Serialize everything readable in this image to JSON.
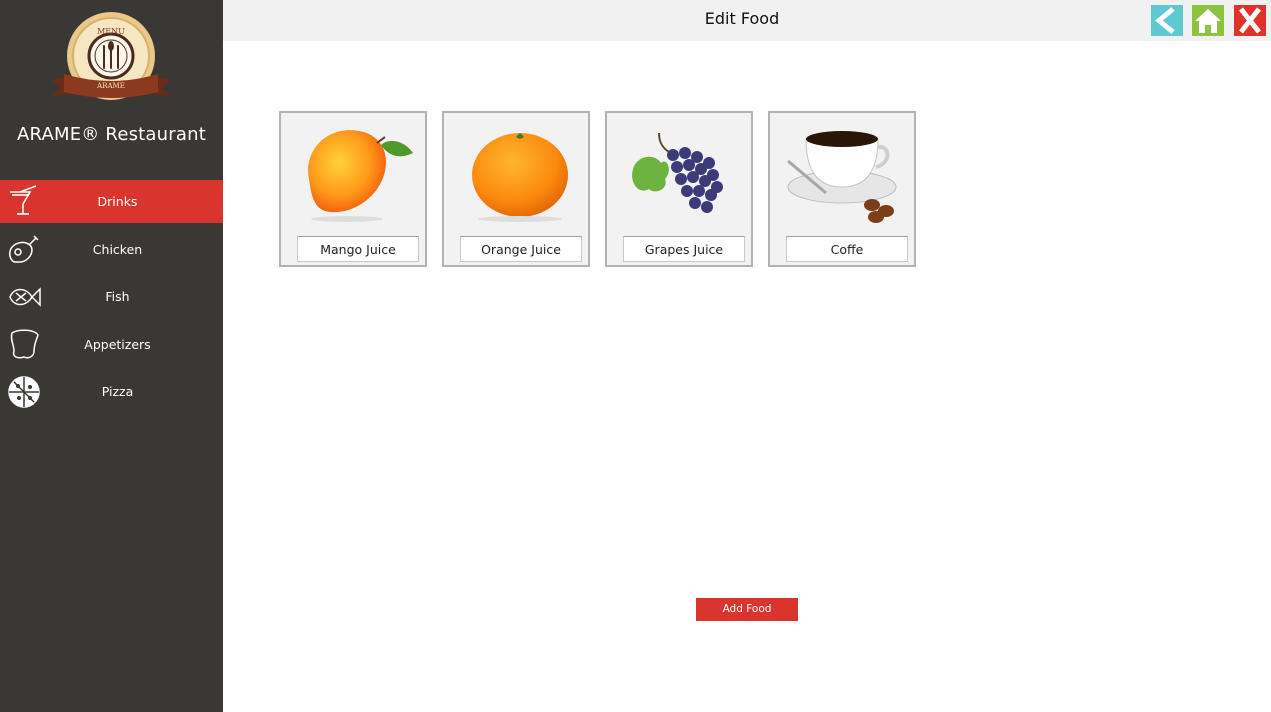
{
  "sidebar": {
    "brand": "ARAME® Restaurant",
    "logo": {
      "top_text": "MENU",
      "ribbon_text": "ARAME"
    },
    "items": [
      {
        "label": "Drinks",
        "icon": "drink-icon",
        "active": true
      },
      {
        "label": "Chicken",
        "icon": "chicken-icon",
        "active": false
      },
      {
        "label": "Fish",
        "icon": "fish-icon",
        "active": false
      },
      {
        "label": "Appetizers",
        "icon": "appetizer-icon",
        "active": false
      },
      {
        "label": "Pizza",
        "icon": "pizza-icon",
        "active": false
      }
    ]
  },
  "header": {
    "title": "Edit Food",
    "buttons": [
      {
        "icon": "back-icon",
        "color": "#5ec9d0"
      },
      {
        "icon": "home-icon",
        "color": "#8cc43f"
      },
      {
        "icon": "close-icon",
        "color": "#e0322b"
      }
    ]
  },
  "foods": [
    {
      "label": "Mango Juice",
      "icon": "mango-image"
    },
    {
      "label": "Orange Juice",
      "icon": "orange-image"
    },
    {
      "label": "Grapes Juice",
      "icon": "grapes-image"
    },
    {
      "label": "Coffe",
      "icon": "coffee-image"
    }
  ],
  "actions": {
    "add_food": "Add Food"
  },
  "colors": {
    "sidebar_bg": "#3a3835",
    "accent_red": "#d9352e",
    "back": "#5ec9d0",
    "home": "#8cc43f"
  }
}
